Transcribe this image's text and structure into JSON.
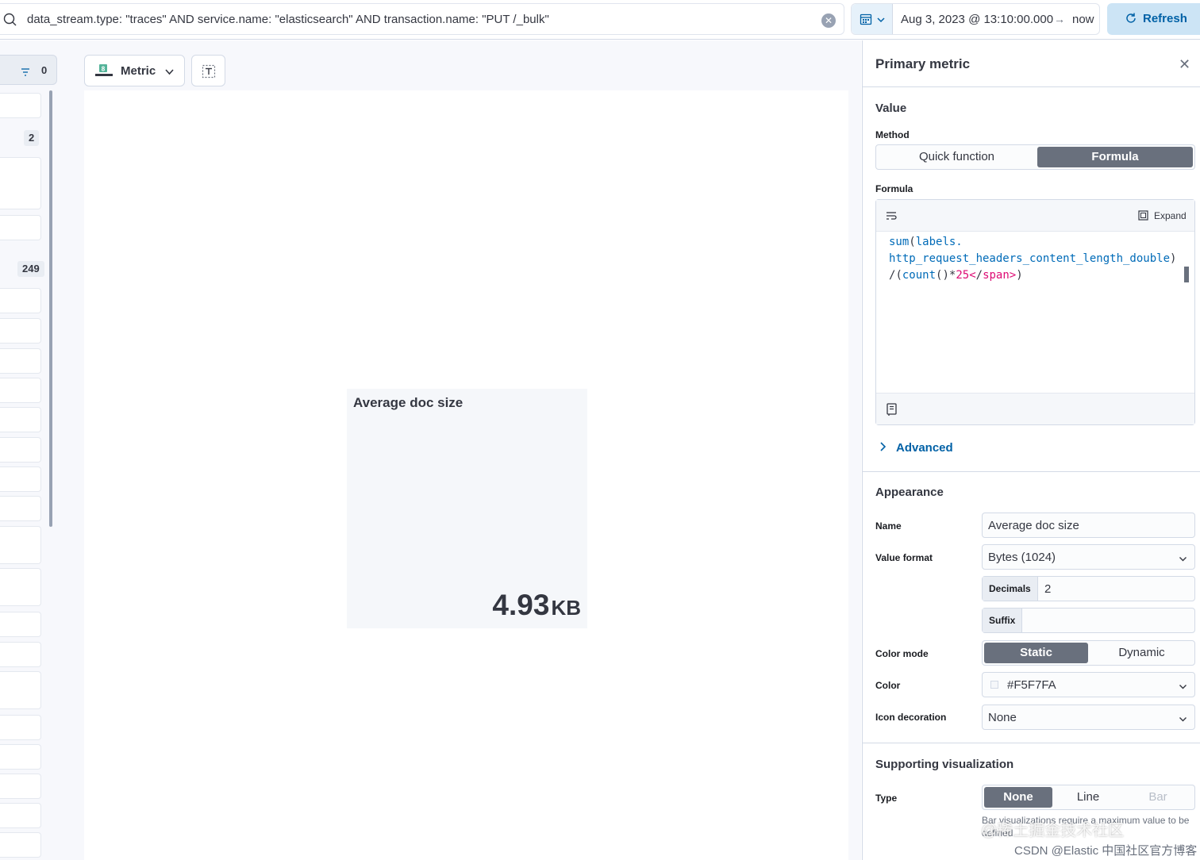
{
  "query_bar": {
    "query": "data_stream.type: \"traces\" AND service.name: \"elasticsearch\" AND transaction.name: \"PUT /_bulk\"",
    "search_icon": "search-icon",
    "clear_icon": "clear-icon"
  },
  "date_picker": {
    "start": "Aug 3, 2023 @ 13:10:00.000",
    "arrow": "→",
    "end": "now"
  },
  "refresh": {
    "label": "Refresh",
    "icon": "refresh-icon"
  },
  "field_list": {
    "filter_count": "0",
    "badges": [
      "2",
      "249"
    ]
  },
  "toolbar": {
    "viz_type": "Metric",
    "viz_icon": "metric-viz-icon",
    "fit_icon": "fit-icon"
  },
  "metric": {
    "title": "Average doc size",
    "value": "4.93",
    "unit": "KB",
    "background_color": "#F5F7FA"
  },
  "panel": {
    "title": "Primary metric",
    "value_section": {
      "title": "Value",
      "method_label": "Method",
      "method_options": [
        "Quick function",
        "Formula"
      ],
      "method_selected": "Formula",
      "formula_label": "Formula",
      "expand_label": "Expand",
      "formula_lines": [
        "sum(labels.",
        "http_request_headers_content_length_double)",
        "/(count()*25)"
      ],
      "advanced_label": "Advanced"
    },
    "appearance": {
      "title": "Appearance",
      "name_label": "Name",
      "name_value": "Average doc size",
      "value_format_label": "Value format",
      "value_format": "Bytes (1024)",
      "decimals_label": "Decimals",
      "decimals_value": "2",
      "suffix_label": "Suffix",
      "suffix_value": "",
      "color_mode_label": "Color mode",
      "color_mode_options": [
        "Static",
        "Dynamic"
      ],
      "color_mode_selected": "Static",
      "color_label": "Color",
      "color_value": "#F5F7FA",
      "icon_label": "Icon decoration",
      "icon_value": "None"
    },
    "supporting": {
      "title": "Supporting visualization",
      "type_label": "Type",
      "type_options": [
        "None",
        "Line",
        "Bar"
      ],
      "type_selected": "None",
      "help": "Bar visualizations require a maximum value to be defined."
    }
  },
  "watermark": {
    "line1": "@稀土掘金技术社区",
    "line2": "CSDN @Elastic 中国社区官方博客"
  },
  "colors": {
    "accent": "#0061a6",
    "selected_segment": "#69707d",
    "border": "#d3dae6"
  }
}
